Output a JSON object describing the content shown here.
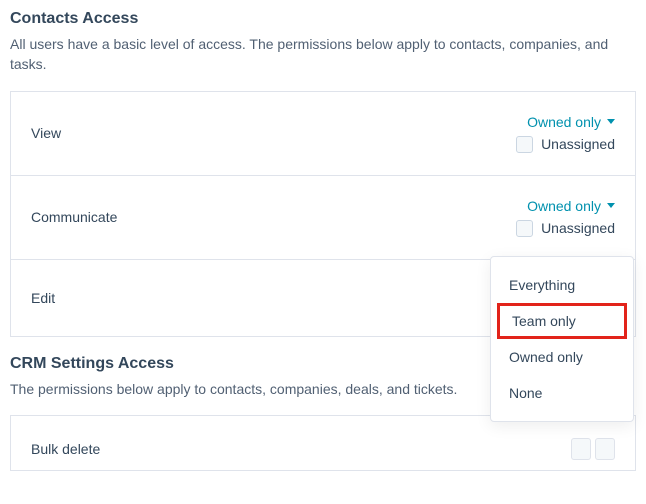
{
  "contacts": {
    "title": "Contacts Access",
    "desc": "All users have a basic level of access. The permissions below apply to contacts, companies, and tasks.",
    "rows": [
      {
        "label": "View",
        "value": "Owned only",
        "unassigned": "Unassigned"
      },
      {
        "label": "Communicate",
        "value": "Owned only",
        "unassigned": "Unassigned"
      },
      {
        "label": "Edit"
      }
    ]
  },
  "dropdown": {
    "items": [
      "Everything",
      "Team only",
      "Owned only",
      "None"
    ],
    "highlight_index": 1
  },
  "crm": {
    "title": "CRM Settings Access",
    "desc": "The permissions below apply to contacts, companies, deals, and tickets.",
    "bulk_label": "Bulk delete"
  }
}
